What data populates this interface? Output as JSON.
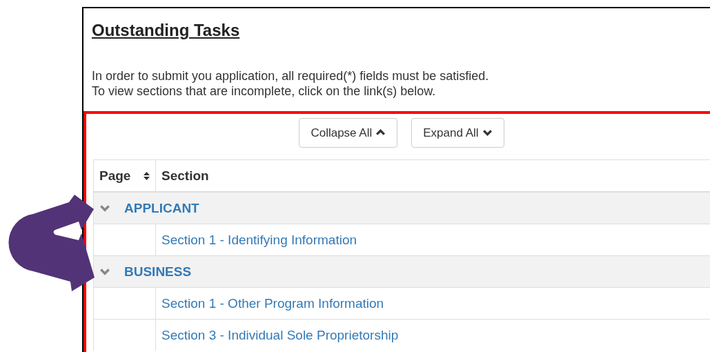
{
  "panel": {
    "title": "Outstanding Tasks",
    "instructions": [
      "In order to submit you application, all required(*) fields must be satisfied.",
      "To view sections that are incomplete, click on the link(s) below."
    ]
  },
  "buttons": [
    {
      "label": "Collapse All",
      "kind": "collapse"
    },
    {
      "label": "Expand All",
      "kind": "expand"
    }
  ],
  "table": {
    "columns": [
      "Page",
      "Section"
    ],
    "groups": [
      {
        "name": "APPLICANT",
        "expanded": true,
        "sections": [
          "Section 1 - Identifying Information"
        ]
      },
      {
        "name": "BUSINESS",
        "expanded": true,
        "sections": [
          "Section 1 - Other Program Information",
          "Section 3 - Individual Sole Proprietorship"
        ]
      }
    ]
  },
  "annotation": {
    "kind": "arrows"
  }
}
